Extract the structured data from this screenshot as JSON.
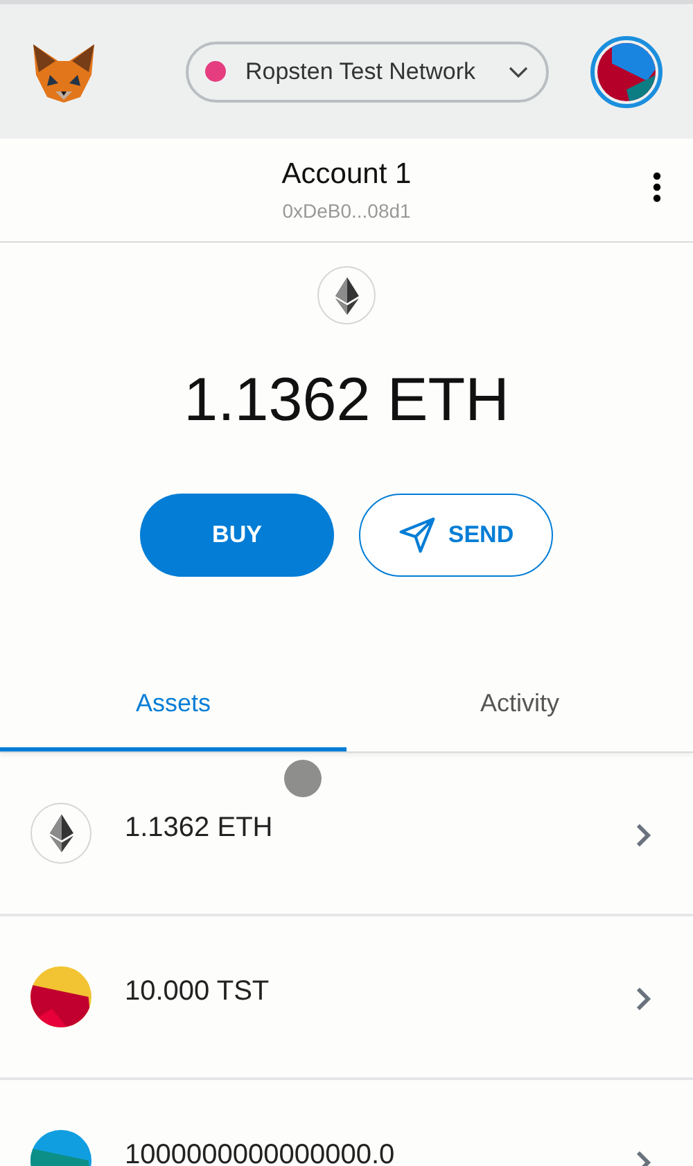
{
  "header": {
    "network": {
      "label": "Ropsten Test Network",
      "color": "#e53d7f"
    }
  },
  "account": {
    "name": "Account 1",
    "address": "0xDeB0...08d1"
  },
  "balance": {
    "amount": "1.1362",
    "unit": "ETH"
  },
  "actions": [
    {
      "kind": "filled",
      "label": "BUY"
    },
    {
      "kind": "outline",
      "label": "SEND"
    }
  ],
  "tabs": [
    {
      "label": "Assets",
      "selected": true
    },
    {
      "label": "Activity",
      "selected": false
    }
  ],
  "assets": [
    {
      "kind": "eth",
      "label": "1.1362 ETH"
    },
    {
      "kind": "token",
      "label": "10.000 TST"
    },
    {
      "kind": "token",
      "label": "1000000000000000.0"
    }
  ]
}
